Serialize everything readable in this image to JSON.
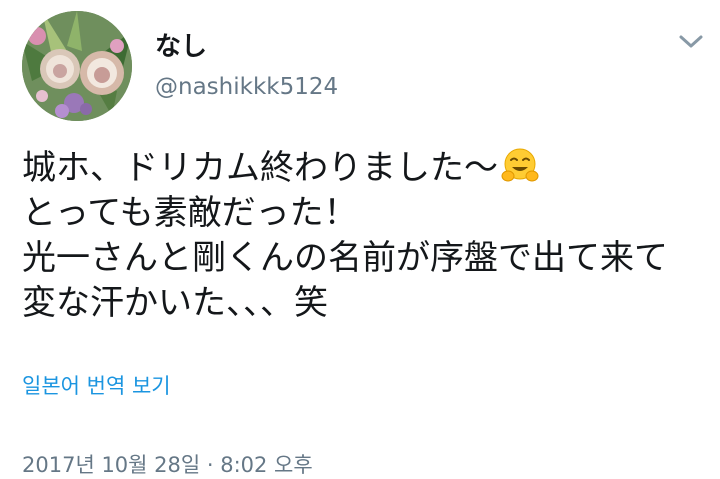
{
  "user": {
    "display_name": "なし",
    "handle": "@nashikkk5124",
    "avatar_icon": "flower-photo-avatar"
  },
  "menu": {
    "icon": "chevron-down-icon"
  },
  "tweet": {
    "lines": [
      "城ホ、ドリカム終わりました〜",
      "とっても素敵だった！",
      "光一さんと剛くんの名前が序盤で出て来て",
      "変な汗かいた、、、笑"
    ],
    "emoji": "hugging-face-emoji"
  },
  "translate_link": "일본어 번역 보기",
  "timestamp": "2017년 10월 28일 · 8:02 오후",
  "colors": {
    "text": "#14171a",
    "secondary": "#657786",
    "link": "#1b95e0",
    "chevron": "#8899a6"
  }
}
